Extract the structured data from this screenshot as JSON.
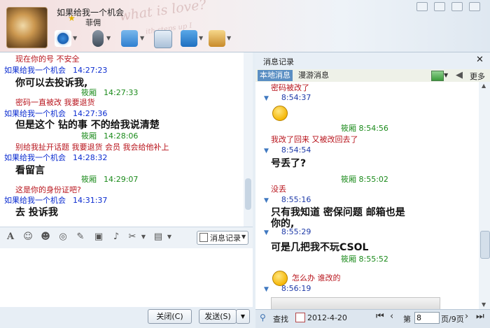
{
  "colors": {
    "sender_blue": "#0a2bd0",
    "self_green": "#1a8a1a",
    "system_red": "#b8141c",
    "tab_active": "#5b8fc3"
  },
  "header": {
    "contact_name": "如果给我一个机会",
    "contact_sub": "菲佣",
    "watermark_main": "what is love?",
    "watermark_sub": "ith steps up I"
  },
  "chat": {
    "lines": [
      {
        "kind": "red",
        "text": "现在你的号 不安全"
      },
      {
        "kind": "sender",
        "name": "如果给我一个机会",
        "time": "14:27:23"
      },
      {
        "kind": "msg",
        "text": "你可以去投诉我,"
      },
      {
        "kind": "me",
        "name": "筱厢",
        "time": "14:27:33"
      },
      {
        "kind": "red",
        "text": "密码一直被改 我要退货"
      },
      {
        "kind": "sender",
        "name": "如果给我一个机会",
        "time": "14:27:36"
      },
      {
        "kind": "msg",
        "text": "但是这个  钻的事  不的给我说清楚"
      },
      {
        "kind": "me",
        "name": "筱厢",
        "time": "14:28:06"
      },
      {
        "kind": "red",
        "text": "别给我扯开话题 我要退货  会员 我会给他补上"
      },
      {
        "kind": "sender",
        "name": "如果给我一个机会",
        "time": "14:28:32"
      },
      {
        "kind": "msg",
        "text": "看留言"
      },
      {
        "kind": "me",
        "name": "筱厢",
        "time": "14:29:07"
      },
      {
        "kind": "red",
        "text": "这是你的身份证吧?"
      },
      {
        "kind": "sender",
        "name": "如果给我一个机会",
        "time": "14:31:37"
      },
      {
        "kind": "msg",
        "text": "去 投诉我"
      }
    ]
  },
  "toolbar": {
    "history_label": "消息记录"
  },
  "footer": {
    "close_label": "关闭(C)",
    "send_label": "发送(S)"
  },
  "history": {
    "title": "消息记录",
    "tab_local": "本地消息",
    "tab_roam": "漫游消息",
    "more_label": "更多",
    "entries": [
      {
        "kind": "red",
        "text": "密码被改了"
      },
      {
        "kind": "time",
        "text": "8:54:37"
      },
      {
        "kind": "emoji",
        "name": "frown-emoji"
      },
      {
        "kind": "me",
        "text": "筱厢 8:54:56"
      },
      {
        "kind": "red",
        "text": "我改了回来 又被改回去了"
      },
      {
        "kind": "time",
        "text": "8:54:54"
      },
      {
        "kind": "msg",
        "text": "号丢了?"
      },
      {
        "kind": "me",
        "text": "筱厢 8:55:02"
      },
      {
        "kind": "red",
        "text": "没丢"
      },
      {
        "kind": "time",
        "text": "8:55:16"
      },
      {
        "kind": "msg",
        "text": "只有我知道    密保问题     邮箱也是"
      },
      {
        "kind": "msg",
        "text": "你的,"
      },
      {
        "kind": "time",
        "text": "8:55:29"
      },
      {
        "kind": "msg",
        "text": "可是几把我不玩CSOL"
      },
      {
        "kind": "me",
        "text": "筱厢 8:55:52"
      },
      {
        "kind": "emoji_text",
        "name": "grin-emoji",
        "text": "怎么办 谁改的"
      },
      {
        "kind": "time",
        "text": "8:56:19"
      }
    ],
    "find_label": "查找",
    "date": "2012-4-20",
    "page_prefix": "第",
    "page_value": "8",
    "page_count": "页/9页"
  }
}
